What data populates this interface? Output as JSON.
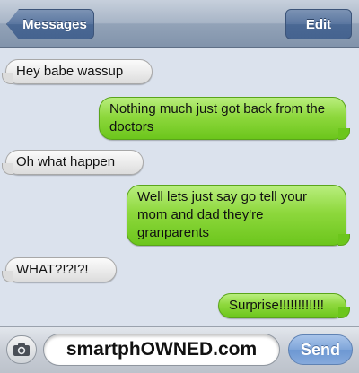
{
  "navbar": {
    "back_label": "Messages",
    "edit_label": "Edit"
  },
  "messages": [
    {
      "from": "them",
      "text": "Hey babe wassup"
    },
    {
      "from": "me",
      "text": "Nothing much just got back from the doctors"
    },
    {
      "from": "them",
      "text": "Oh what happen"
    },
    {
      "from": "me",
      "text": "Well lets just say go tell your mom and dad they're granparents"
    },
    {
      "from": "them",
      "text": "WHAT?!?!?!"
    },
    {
      "from": "me",
      "text": "Surprise!!!!!!!!!!!!"
    }
  ],
  "composer": {
    "field_value": "smartphOWNED.com",
    "send_label": "Send",
    "camera_icon": "camera-icon"
  },
  "colors": {
    "incoming_bubble": "#e9e9e9",
    "outgoing_bubble": "#8ed83d",
    "nav_button": "#5a76a0",
    "background": "#dbe2ed"
  }
}
